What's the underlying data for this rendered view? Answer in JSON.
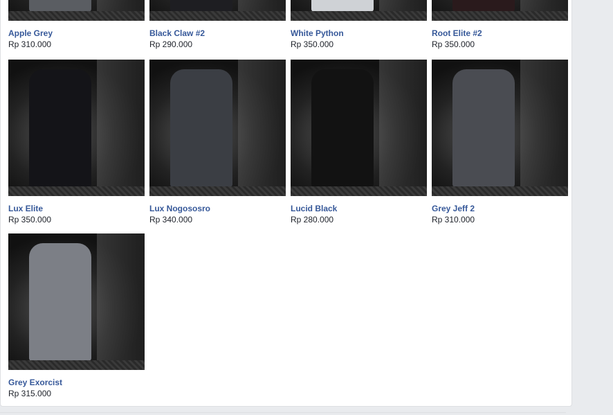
{
  "products": [
    {
      "name": "Apple Grey",
      "price": "Rp 310.000",
      "shirt_color": "#5a5d62"
    },
    {
      "name": "Black Claw #2",
      "price": "Rp 290.000",
      "shirt_color": "#1e1e22"
    },
    {
      "name": "White Python",
      "price": "Rp 350.000",
      "shirt_color": "#cfd2d6"
    },
    {
      "name": "Root Elite #2",
      "price": "Rp 350.000",
      "shirt_color": "#2a1a1c"
    },
    {
      "name": "Lux Elite",
      "price": "Rp 350.000",
      "shirt_color": "#141418"
    },
    {
      "name": "Lux Nogososro",
      "price": "Rp 340.000",
      "shirt_color": "#3b3e44"
    },
    {
      "name": "Lucid Black",
      "price": "Rp 280.000",
      "shirt_color": "#121212"
    },
    {
      "name": "Grey Jeff 2",
      "price": "Rp 310.000",
      "shirt_color": "#4a4c52"
    },
    {
      "name": "Grey Exorcist",
      "price": "Rp 315.000",
      "shirt_color": "#7c7f86"
    }
  ],
  "colors": {
    "link": "#365899",
    "background": "#e9ebee"
  }
}
